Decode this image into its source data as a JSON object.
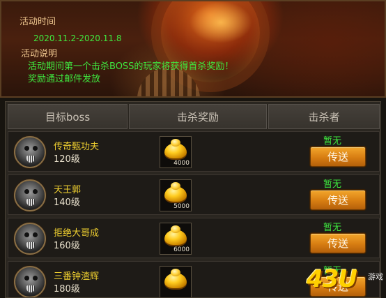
{
  "event": {
    "time_label": "活动时间",
    "date_range": "2020.11.2-2020.11.8",
    "desc_label": "活动说明",
    "desc_line1": "活动期间第一个击杀BOSS的玩家将获得首杀奖励！",
    "desc_line2": "奖励通过邮件发放"
  },
  "table": {
    "headers": {
      "target": "目标boss",
      "reward": "击杀奖励",
      "killer": "击杀者"
    },
    "rows": [
      {
        "name": "传奇甄功夫",
        "level": "120级",
        "reward_icon": "gold-ingot-icon",
        "reward_qty": "4000",
        "killer": "暂无",
        "button": "传送"
      },
      {
        "name": "天王郭",
        "level": "140级",
        "reward_icon": "gold-ingot-icon",
        "reward_qty": "5000",
        "killer": "暂无",
        "button": "传送"
      },
      {
        "name": "拒绝大哥成",
        "level": "160级",
        "reward_icon": "gold-ingot-icon",
        "reward_qty": "6000",
        "killer": "暂无",
        "button": "传送"
      },
      {
        "name": "三番钟渣辉",
        "level": "180级",
        "reward_icon": "gold-ingot-icon",
        "reward_qty": "",
        "killer": "暂无",
        "button": "传送"
      }
    ]
  },
  "watermark": {
    "logo": "43U",
    "sub": "游戏"
  },
  "colors": {
    "accent_green": "#3fe83f",
    "boss_name": "#f0d030",
    "button_orange": "#d77d12"
  }
}
